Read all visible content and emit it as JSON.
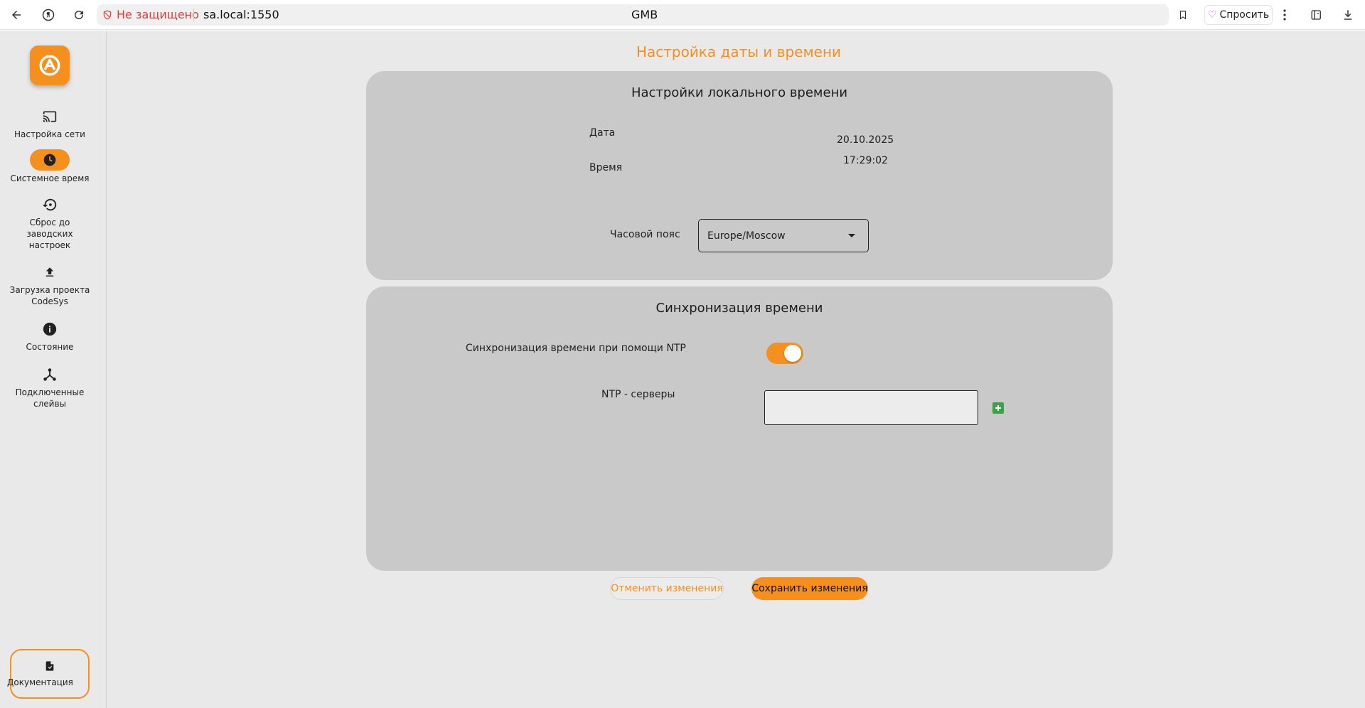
{
  "browser": {
    "not_secure_label": "Не защищено",
    "url": "sa.local:1550",
    "page_title": "GMB",
    "ask_label": "Спросить"
  },
  "sidebar": {
    "items": [
      {
        "label": "Настройка сети",
        "icon": "cast-icon"
      },
      {
        "label": "Системное время",
        "icon": "clock-icon",
        "active": true
      },
      {
        "label": "Сброс до заводских настроек",
        "icon": "reset-icon"
      },
      {
        "label": "Загрузка проекта CodeSys",
        "icon": "upload-icon"
      },
      {
        "label": "Состояние",
        "icon": "info-icon"
      },
      {
        "label": "Подключенные слейвы",
        "icon": "hub-icon"
      }
    ],
    "doc_label": "Документация"
  },
  "main": {
    "title": "Настройка даты и времени",
    "local": {
      "title": "Настройки локального времени",
      "date_label": "Дата",
      "date_value": "20.10.2025",
      "time_label": "Время",
      "time_value": "17:29:02",
      "tz_label": "Часовой пояс",
      "tz_value": "Europe/Moscow"
    },
    "sync": {
      "title": "Синхронизация времени",
      "ntp_toggle_label": "Синхронизация времени при помощи NTP",
      "ntp_enabled": true,
      "servers_label": "NTP - серверы",
      "servers_value": ""
    },
    "cancel_label": "Отменить изменения",
    "save_label": "Сохранить изменения"
  },
  "colors": {
    "accent": "#f5901e",
    "card": "#c9c9c9",
    "background": "#e9e9e9",
    "add_button": "#3aa345",
    "not_secure": "#e03a3a"
  }
}
